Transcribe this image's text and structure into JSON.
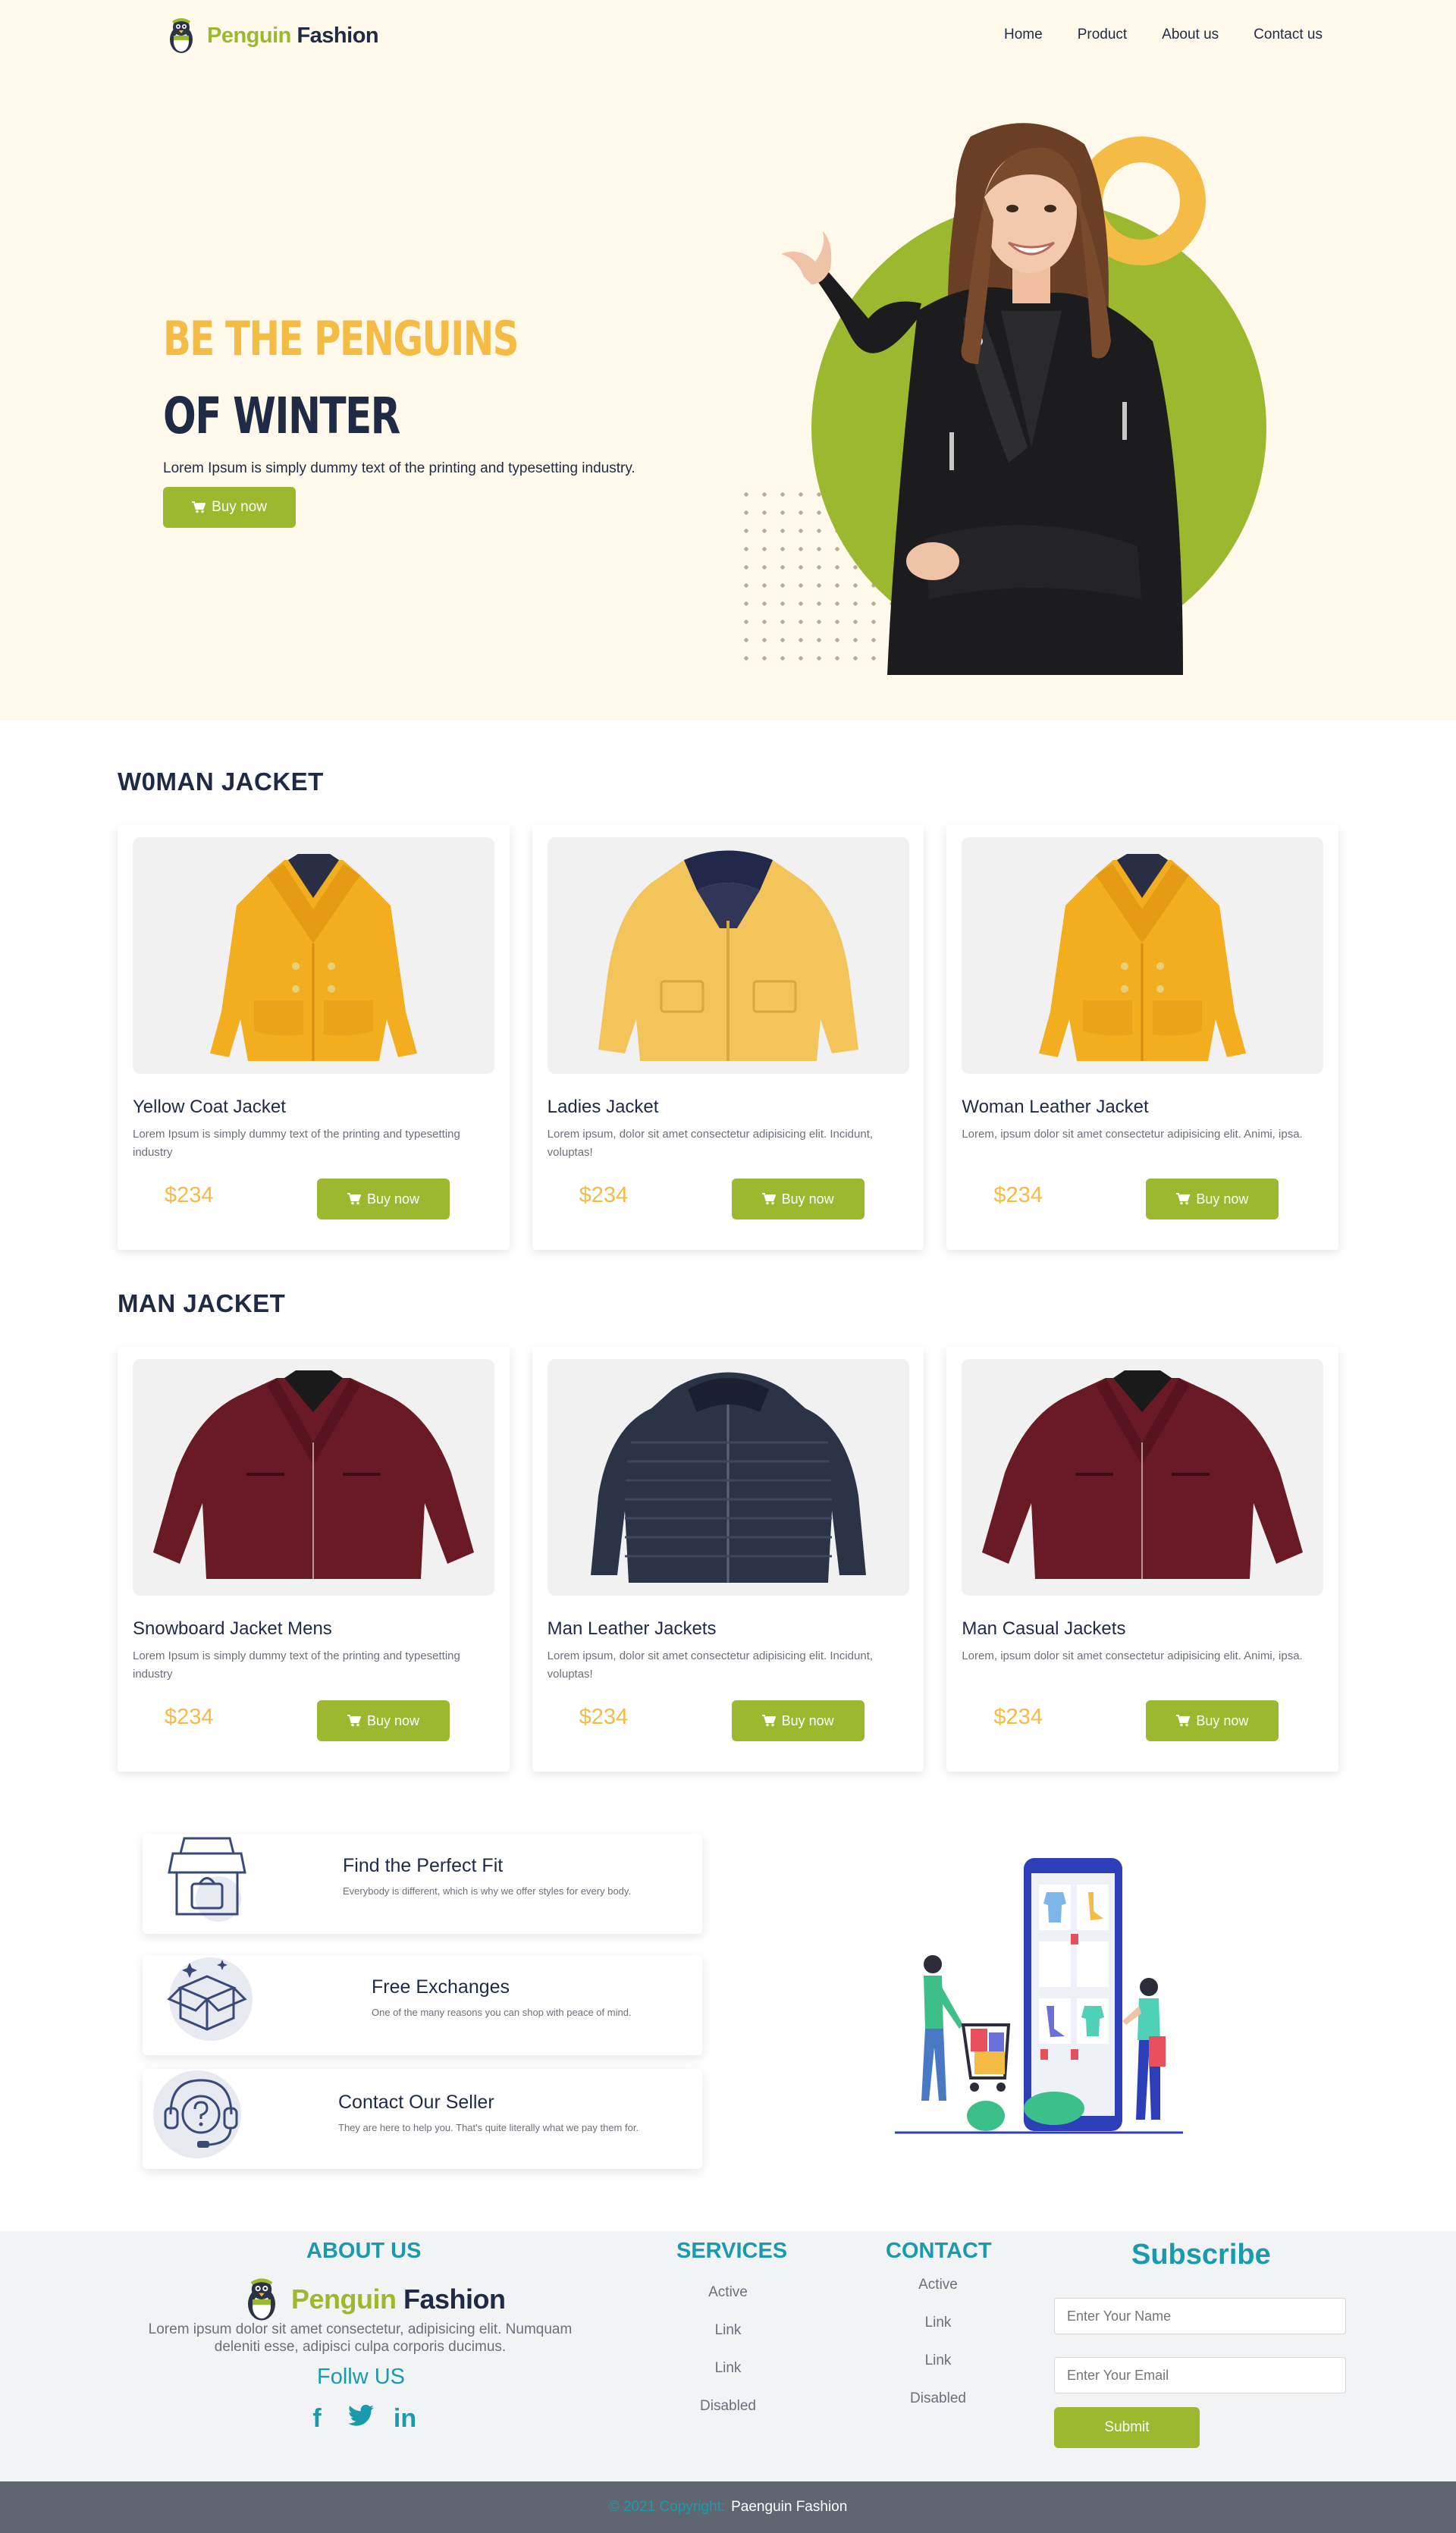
{
  "brand": {
    "name_part1": "Penguin",
    "name_part2": "Fashion"
  },
  "nav": {
    "items": [
      "Home",
      "Product",
      "About us",
      "Contact us"
    ]
  },
  "hero": {
    "title_line1": "BE THE PENGUINS",
    "title_line2": "OF WINTER",
    "description": "Lorem Ipsum is simply dummy text of the printing and typesetting industry.",
    "button_label": "Buy now"
  },
  "woman_section": {
    "title": "W0MAN JACKET",
    "products": [
      {
        "name": "Yellow Coat Jacket",
        "description": "Lorem Ipsum is simply dummy text of the printing and typesetting industry",
        "price": "$234",
        "button": "Buy now",
        "image": "yellow-coat-image"
      },
      {
        "name": "Ladies Jacket",
        "description": "Lorem ipsum, dolor sit amet consectetur adipisicing elit. Incidunt, voluptas!",
        "price": "$234",
        "button": "Buy now",
        "image": "yellow-rain-jacket-image"
      },
      {
        "name": "Woman Leather Jacket",
        "description": "Lorem, ipsum dolor sit amet consectetur adipisicing elit. Animi, ipsa.",
        "price": "$234",
        "button": "Buy now",
        "image": "yellow-coat-image"
      }
    ]
  },
  "man_section": {
    "title": "MAN JACKET",
    "products": [
      {
        "name": "Snowboard Jacket Mens",
        "description": "Lorem Ipsum is simply dummy text of the printing and typesetting industry",
        "price": "$234",
        "button": "Buy now",
        "image": "maroon-leather-jacket-image"
      },
      {
        "name": "Man Leather Jackets",
        "description": "Lorem ipsum, dolor sit amet consectetur adipisicing elit. Incidunt, voluptas!",
        "price": "$234",
        "button": "Buy now",
        "image": "navy-puffer-jacket-image"
      },
      {
        "name": "Man Casual Jackets",
        "description": "Lorem, ipsum dolor sit amet consectetur adipisicing elit. Animi, ipsa.",
        "price": "$234",
        "button": "Buy now",
        "image": "maroon-leather-jacket-image"
      }
    ]
  },
  "features": [
    {
      "title": "Find the Perfect Fit",
      "description": "Everybody is different, which is why we offer styles for every body.",
      "icon": "storefront-bag-icon"
    },
    {
      "title": "Free Exchanges",
      "description": "One of the many reasons you can shop with peace of mind.",
      "icon": "open-box-icon"
    },
    {
      "title": "Contact Our Seller",
      "description": "They are here to help you. That's quite literally what we pay them for.",
      "icon": "headset-support-icon"
    }
  ],
  "footer": {
    "about_title": "ABOUT US",
    "about_text": "Lorem ipsum dolor sit amet consectetur, adipisicing elit. Numquam deleniti esse, adipisci culpa corporis ducimus.",
    "follow_title": "Follw US",
    "social": [
      "facebook-icon",
      "twitter-icon",
      "linkedin-icon"
    ],
    "services_title": "SERVICES",
    "services_links": [
      "Active",
      "Link",
      "Link",
      "Disabled"
    ],
    "contact_title": "CONTACT",
    "contact_links": [
      "Active",
      "Link",
      "Link",
      "Disabled"
    ],
    "subscribe_title": "Subscribe",
    "name_placeholder": "Enter Your Name",
    "email_placeholder": "Enter Your Email",
    "submit_label": "Submit"
  },
  "copyright": {
    "prefix": "© 2021 Copyright:",
    "brand": "Paenguin Fashion"
  },
  "colors": {
    "accent_green": "#9cb82f",
    "accent_yellow": "#f4bb45",
    "navy": "#1f2a44",
    "teal": "#1a9bad",
    "hero_bg": "#fff9ec"
  }
}
